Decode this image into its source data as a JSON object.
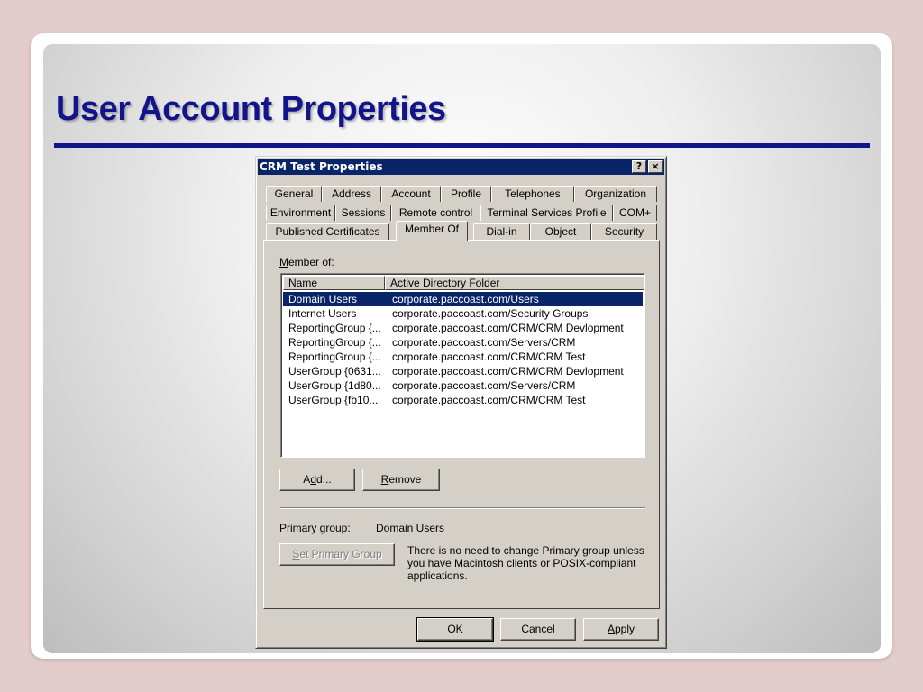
{
  "slide": {
    "title": "User Account Properties"
  },
  "dialog": {
    "title": "CRM Test Properties",
    "help_button": "?",
    "close_button": "×",
    "tabs_row1": [
      "General",
      "Address",
      "Account",
      "Profile",
      "Telephones",
      "Organization"
    ],
    "tabs_row2": [
      "Environment",
      "Sessions",
      "Remote control",
      "Terminal Services Profile",
      "COM+"
    ],
    "tabs_row3": [
      "Published Certificates",
      "Member Of",
      "Dial-in",
      "Object",
      "Security"
    ],
    "active_tab": "Member Of",
    "member_of": {
      "label_accesskey": "M",
      "label_rest": "ember of:",
      "columns": [
        "Name",
        "Active Directory Folder"
      ],
      "rows": [
        {
          "name": "Domain Users",
          "folder": "corporate.paccoast.com/Users",
          "selected": true
        },
        {
          "name": "Internet Users",
          "folder": "corporate.paccoast.com/Security Groups",
          "selected": false
        },
        {
          "name": "ReportingGroup {...",
          "folder": "corporate.paccoast.com/CRM/CRM Devlopment",
          "selected": false
        },
        {
          "name": "ReportingGroup {...",
          "folder": "corporate.paccoast.com/Servers/CRM",
          "selected": false
        },
        {
          "name": "ReportingGroup {...",
          "folder": "corporate.paccoast.com/CRM/CRM Test",
          "selected": false
        },
        {
          "name": "UserGroup {0631...",
          "folder": "corporate.paccoast.com/CRM/CRM Devlopment",
          "selected": false
        },
        {
          "name": "UserGroup {1d80...",
          "folder": "corporate.paccoast.com/Servers/CRM",
          "selected": false
        },
        {
          "name": "UserGroup {fb10...",
          "folder": "corporate.paccoast.com/CRM/CRM Test",
          "selected": false
        }
      ]
    },
    "add_button": {
      "pre": "A",
      "key": "d",
      "post": "d..."
    },
    "remove_button": {
      "pre": "",
      "key": "R",
      "post": "emove"
    },
    "primary_group_label": "Primary group:",
    "primary_group_value": "Domain Users",
    "set_primary_button": {
      "pre": "",
      "key": "S",
      "post": "et Primary Group"
    },
    "primary_group_note": "There is no need to change Primary group unless you have Macintosh clients or POSIX-compliant applications.",
    "ok_button": "OK",
    "cancel_button": "Cancel",
    "apply_button": {
      "pre": "",
      "key": "A",
      "post": "pply"
    }
  }
}
